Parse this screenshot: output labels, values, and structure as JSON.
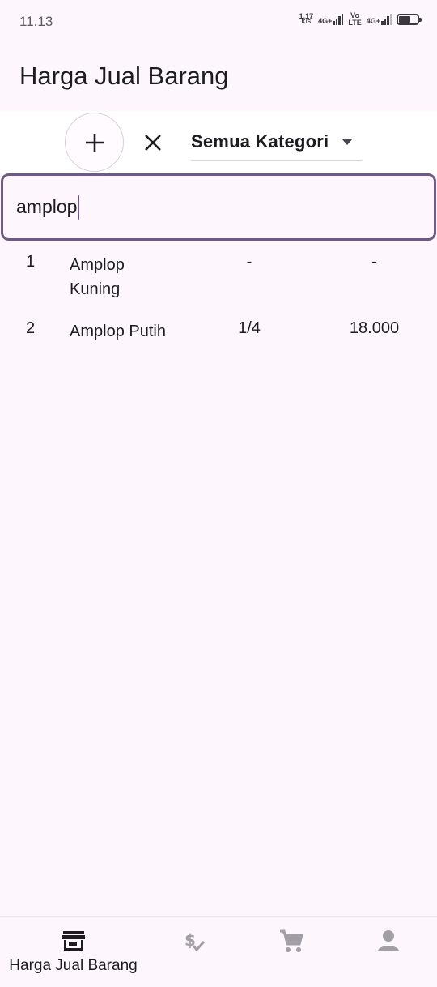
{
  "status_bar": {
    "time": "11.13",
    "net_speed": "1,17",
    "net_speed_unit": "K/S",
    "sig1": "4G+",
    "volte_top": "Vo",
    "volte_bottom": "LTE",
    "sig2": "4G+",
    "battery_level": 0.65
  },
  "app_bar": {
    "title": "Harga Jual Barang"
  },
  "toolbar": {
    "add_icon": "plus-icon",
    "clear_icon": "close-icon",
    "category_selected": "Semua Kategori",
    "dropdown_icon": "caret-down-icon"
  },
  "search": {
    "value": "amplop"
  },
  "items": [
    {
      "no": "1",
      "name": "Amplop Kuning",
      "unit": "-",
      "price": "-"
    },
    {
      "no": "2",
      "name": "Amplop Putih",
      "unit": "1/4",
      "price": "18.000"
    }
  ],
  "bottom_nav": {
    "items": [
      {
        "label": "Harga Jual Barang",
        "icon": "store-icon",
        "active": true
      },
      {
        "label": "",
        "icon": "dollar-check-icon",
        "active": false
      },
      {
        "label": "",
        "icon": "cart-icon",
        "active": false
      },
      {
        "label": "",
        "icon": "person-icon",
        "active": false
      }
    ]
  },
  "colors": {
    "background": "#fdf7fd",
    "accent": "#6d5a85",
    "inactive_icon": "#a29ea6"
  }
}
